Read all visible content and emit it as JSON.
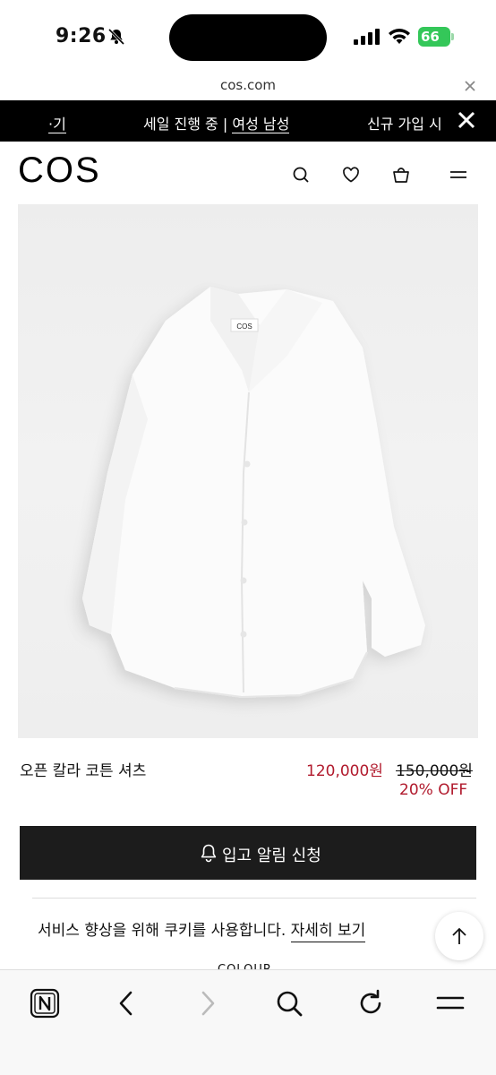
{
  "status": {
    "time": "9:26",
    "battery": "66"
  },
  "browser": {
    "url": "cos.com"
  },
  "promo": {
    "left_text": "·기",
    "center_text": "세일 진행 중 | ",
    "center_link": "여성 남성",
    "right_text": "신규 가입 시"
  },
  "header": {
    "logo": "COS"
  },
  "product": {
    "name": "오픈 칼라 코튼 셔츠",
    "sale_price": "120,000원",
    "original_price": "150,000원",
    "discount": "20% OFF",
    "label_tag": "COS"
  },
  "notify_button": {
    "label": "입고 알림 신청"
  },
  "cookie_banner": {
    "text": "서비스 향상을 위해 쿠키를 사용합니다.",
    "link": "자세히 보기"
  },
  "section_peek": {
    "label": "COLOUR"
  },
  "colors": {
    "sale_red": "#b11a2d",
    "battery_green": "#34c759",
    "button_dark": "#1c1c1c"
  },
  "icons": [
    "bell-muted-icon",
    "signal-icon",
    "wifi-icon",
    "close-icon",
    "search-icon",
    "heart-icon",
    "bag-icon",
    "menu-icon",
    "bell-icon",
    "arrow-up-icon",
    "notion-icon",
    "back-icon",
    "forward-icon",
    "reload-icon"
  ]
}
